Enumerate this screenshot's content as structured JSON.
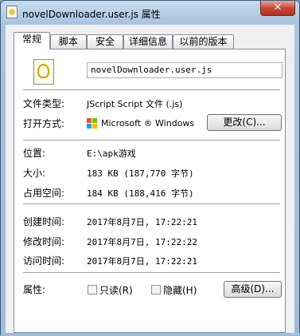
{
  "window": {
    "title": "novelDownloader.user.js 属性",
    "close_glyph": "✕"
  },
  "tabs": [
    "常规",
    "脚本",
    "安全",
    "详细信息",
    "以前的版本"
  ],
  "file": {
    "name": "novelDownloader.user.js"
  },
  "rows": {
    "type_label": "文件类型:",
    "type_value": "JScript Script 文件 (.js)",
    "open_label": "打开方式:",
    "open_value": "Microsoft ® Windows",
    "change_button": "更改(C)...",
    "location_label": "位置:",
    "location_value": "E:\\apk游戏",
    "size_label": "大小:",
    "size_value": "183 KB (187,770 字节)",
    "disk_label": "占用空间:",
    "disk_value": "184 KB (188,416 字节)",
    "created_label": "创建时间:",
    "created_value": "2017年8月7日, 17:22:21",
    "modified_label": "修改时间:",
    "modified_value": "2017年8月7日, 17:22:22",
    "accessed_label": "访问时间:",
    "accessed_value": "2017年8月7日, 17:22:21",
    "attr_label": "属性:",
    "readonly_label": "只读(R)",
    "hidden_label": "隐藏(H)",
    "advanced_button": "高级(D)..."
  },
  "colors": {
    "ms_red": "#f25022",
    "ms_green": "#7fba00",
    "ms_blue": "#00a4ef",
    "ms_yellow": "#ffb900"
  }
}
